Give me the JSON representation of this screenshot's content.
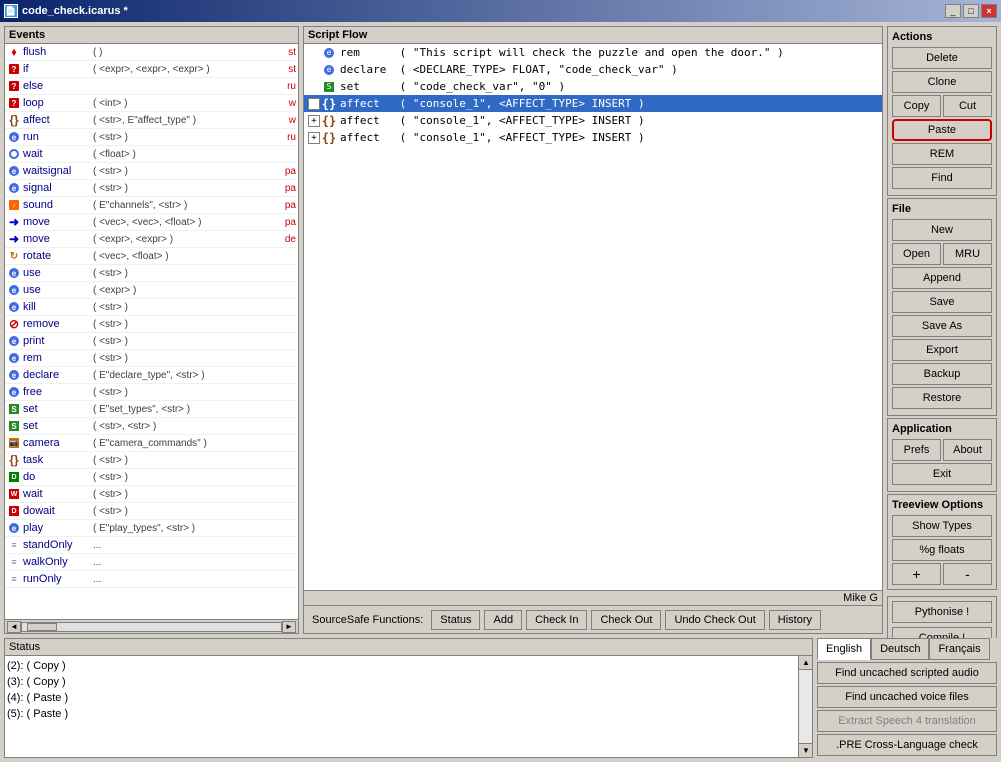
{
  "window": {
    "title": "code_check.icarus *",
    "icon": "📄"
  },
  "events_panel": {
    "header": "Events",
    "items": [
      {
        "icon": "flush",
        "name": "flush",
        "params": "( )",
        "right": "st"
      },
      {
        "icon": "q-red",
        "name": "if",
        "params": "( <expr>, <expr>, <expr> )",
        "right": "st"
      },
      {
        "icon": "q-red",
        "name": "else",
        "params": "",
        "right": "ru"
      },
      {
        "icon": "q-red",
        "name": "loop",
        "params": "( <int> )",
        "right": "w"
      },
      {
        "icon": "curly",
        "name": "affect",
        "params": "( <str>, E\"affect_type\" )",
        "right": "w"
      },
      {
        "icon": "e-blue",
        "name": "run",
        "params": "( <str> )",
        "right": "ru"
      },
      {
        "icon": "wait",
        "name": "wait",
        "params": "( <float> )",
        "right": ""
      },
      {
        "icon": "e-blue",
        "name": "waitsignal",
        "params": "( <str> )",
        "right": "pa"
      },
      {
        "icon": "e-blue",
        "name": "signal",
        "params": "( <str> )",
        "right": "pa"
      },
      {
        "icon": "sound",
        "name": "sound",
        "params": "( E\"channels\", <str> )",
        "right": "pa"
      },
      {
        "icon": "move-arrow",
        "name": "move",
        "params": "( <vec>, <vec>, <float> )",
        "right": "pa"
      },
      {
        "icon": "move-arrow",
        "name": "move",
        "params": "( <expr>, <expr> )",
        "right": "de"
      },
      {
        "icon": "rotate",
        "name": "rotate",
        "params": "( <vec>, <float> )",
        "right": ""
      },
      {
        "icon": "e-blue",
        "name": "use",
        "params": "( <str> )",
        "right": ""
      },
      {
        "icon": "e-blue",
        "name": "use",
        "params": "( <expr> )",
        "right": ""
      },
      {
        "icon": "e-blue",
        "name": "kill",
        "params": "( <str> )",
        "right": ""
      },
      {
        "icon": "remove",
        "name": "remove",
        "params": "( <str> )",
        "right": ""
      },
      {
        "icon": "e-blue",
        "name": "print",
        "params": "( <str> )",
        "right": ""
      },
      {
        "icon": "e-blue",
        "name": "rem",
        "params": "( <str> )",
        "right": ""
      },
      {
        "icon": "e-blue",
        "name": "declare",
        "params": "( E\"declare_type\", <str> )",
        "right": ""
      },
      {
        "icon": "e-blue",
        "name": "free",
        "params": "( <str> )",
        "right": ""
      },
      {
        "icon": "set",
        "name": "set",
        "params": "( E\"set_types\", <str> )",
        "right": ""
      },
      {
        "icon": "set",
        "name": "set",
        "params": "( <str>, <str> )",
        "right": ""
      },
      {
        "icon": "camera",
        "name": "camera",
        "params": "( E\"camera_commands\" )",
        "right": ""
      },
      {
        "icon": "curly",
        "name": "task",
        "params": "( <str> )",
        "right": ""
      },
      {
        "icon": "do",
        "name": "do",
        "params": "( <str> )",
        "right": ""
      },
      {
        "icon": "wait-red",
        "name": "wait",
        "params": "( <str> )",
        "right": ""
      },
      {
        "icon": "dowait",
        "name": "dowait",
        "params": "( <str> )",
        "right": ""
      },
      {
        "icon": "e-blue",
        "name": "play",
        "params": "( E\"play_types\", <str> )",
        "right": ""
      },
      {
        "icon": "lines",
        "name": "standOnly",
        "params": "...",
        "right": ""
      },
      {
        "icon": "lines",
        "name": "walkOnly",
        "params": "...",
        "right": ""
      },
      {
        "icon": "lines",
        "name": "runOnly",
        "params": "...",
        "right": ""
      }
    ]
  },
  "script_panel": {
    "header": "Script Flow",
    "rows": [
      {
        "indent": 0,
        "expand": false,
        "icon": "e-blue",
        "content": "rem      ( \"This script will check the puzzle and open the door.\" )"
      },
      {
        "indent": 0,
        "expand": false,
        "icon": "e-blue",
        "content": "declare  ( <DECLARE_TYPE> FLOAT, \"code_check_var\" )"
      },
      {
        "indent": 0,
        "expand": false,
        "icon": "set",
        "content": "set      ( \"code_check_var\", \"0\" )"
      },
      {
        "indent": 0,
        "expand": true,
        "icon": "curly",
        "content": "affect   ( \"console_1\", <AFFECT_TYPE> INSERT )",
        "selected": true
      },
      {
        "indent": 0,
        "expand": true,
        "icon": "curly",
        "content": "affect   ( \"console_1\", <AFFECT_TYPE> INSERT )"
      },
      {
        "indent": 0,
        "expand": true,
        "icon": "curly",
        "content": "affect   ( \"console_1\", <AFFECT_TYPE> INSERT )"
      }
    ],
    "user": "Mike G"
  },
  "sourcesafe": {
    "label": "SourceSafe Functions:",
    "buttons": [
      "Status",
      "Add",
      "Check In",
      "Check Out",
      "Undo Check Out",
      "History"
    ]
  },
  "actions": {
    "header": "Actions",
    "buttons": {
      "delete": "Delete",
      "clone": "Clone",
      "copy": "Copy",
      "cut": "Cut",
      "paste": "Paste",
      "rem": "REM",
      "find": "Find"
    }
  },
  "file": {
    "header": "File",
    "new": "New",
    "open": "Open",
    "mru": "MRU",
    "append": "Append",
    "save": "Save",
    "save_as": "Save As",
    "export": "Export",
    "backup": "Backup",
    "restore": "Restore"
  },
  "application": {
    "header": "Application",
    "prefs": "Prefs",
    "about": "About",
    "exit": "Exit"
  },
  "treeview": {
    "header": "Treeview Options",
    "show_types": "Show Types",
    "floats": "%g floats",
    "plus": "+",
    "minus": "-",
    "pythonise": "Pythonise !",
    "compile": "Compile !"
  },
  "status": {
    "header": "Status",
    "rows": [
      "(2): ( Copy )",
      "(3): ( Copy )",
      "(4): ( Paste )",
      "(5): ( Paste )"
    ]
  },
  "lang": {
    "buttons": [
      "English",
      "Deutsch",
      "Français"
    ]
  },
  "extra_buttons": [
    "Find uncached scripted audio",
    "Find uncached voice files",
    "Extract Speech 4 translation",
    ".PRE Cross-Language check"
  ]
}
